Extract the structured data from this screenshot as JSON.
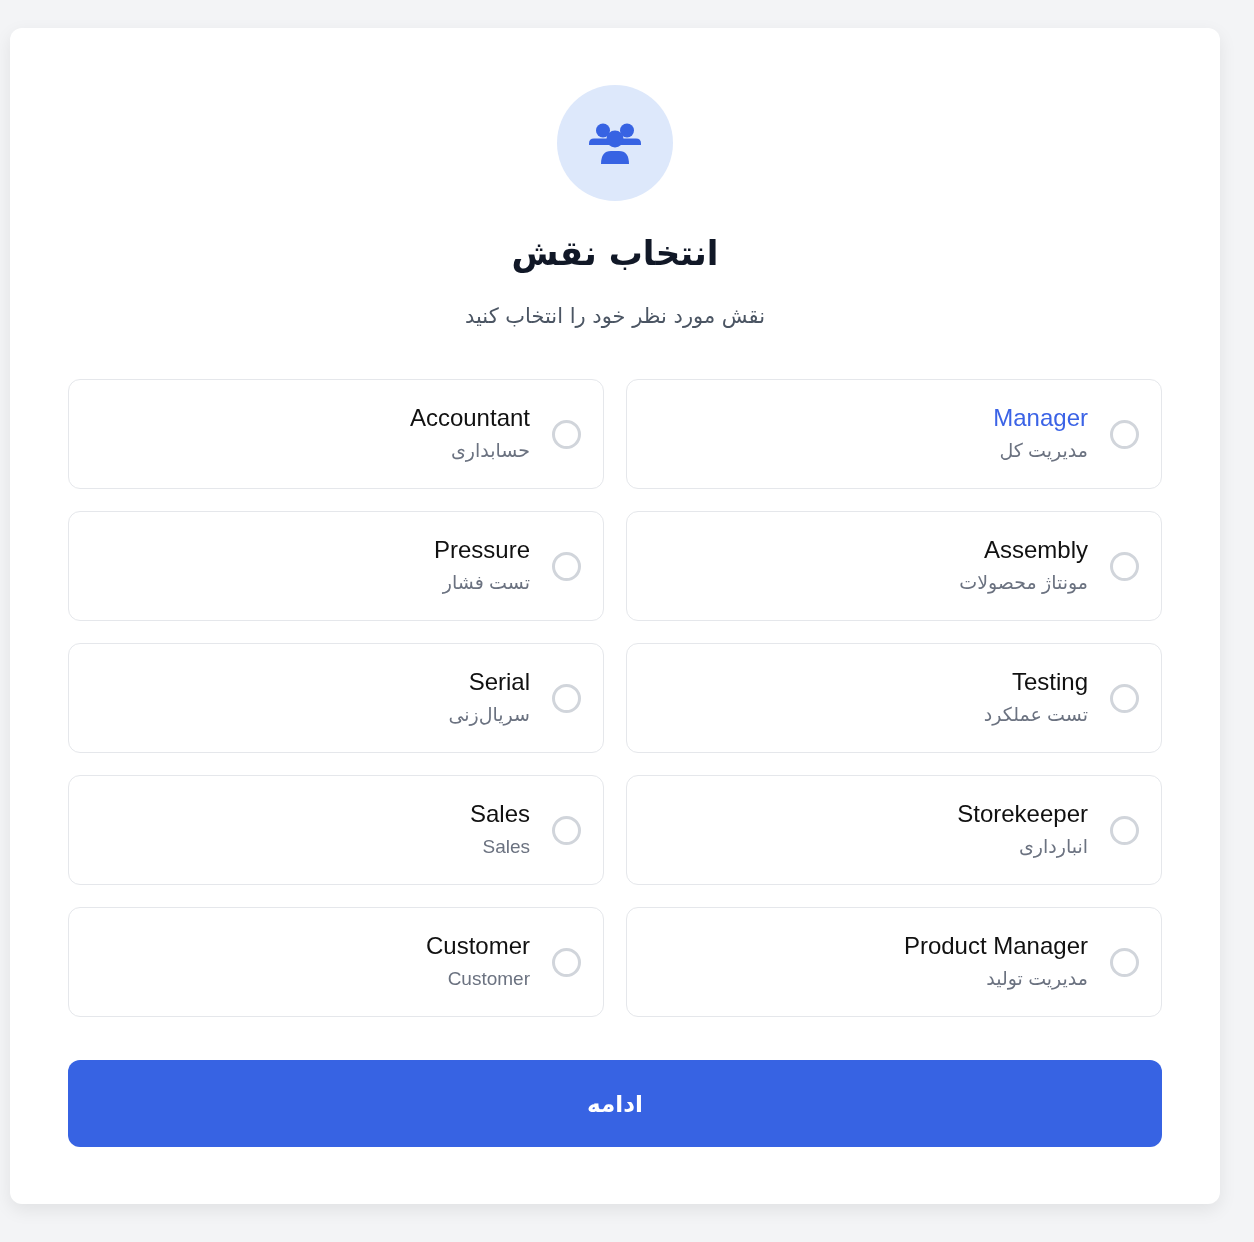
{
  "header": {
    "title": "انتخاب نقش",
    "subtitle": "نقش مورد نظر خود را انتخاب کنید"
  },
  "roles": [
    {
      "name": "Manager",
      "description": "مدیریت کل",
      "selected": false,
      "hovered": true
    },
    {
      "name": "Accountant",
      "description": "حسابداری",
      "selected": false,
      "hovered": false
    },
    {
      "name": "Assembly",
      "description": "مونتاژ محصولات",
      "selected": false,
      "hovered": false
    },
    {
      "name": "Pressure",
      "description": "تست فشار",
      "selected": false,
      "hovered": false
    },
    {
      "name": "Testing",
      "description": "تست عملکرد",
      "selected": false,
      "hovered": false
    },
    {
      "name": "Serial",
      "description": "سریال‌زنی",
      "selected": false,
      "hovered": false
    },
    {
      "name": "Storekeeper",
      "description": "انبارداری",
      "selected": false,
      "hovered": false
    },
    {
      "name": "Sales",
      "description": "Sales",
      "selected": false,
      "hovered": false
    },
    {
      "name": "Product Manager",
      "description": "مدیریت تولید",
      "selected": false,
      "hovered": false
    },
    {
      "name": "Customer",
      "description": "Customer",
      "selected": false,
      "hovered": false
    }
  ],
  "continue_button": {
    "label": "ادامه"
  }
}
